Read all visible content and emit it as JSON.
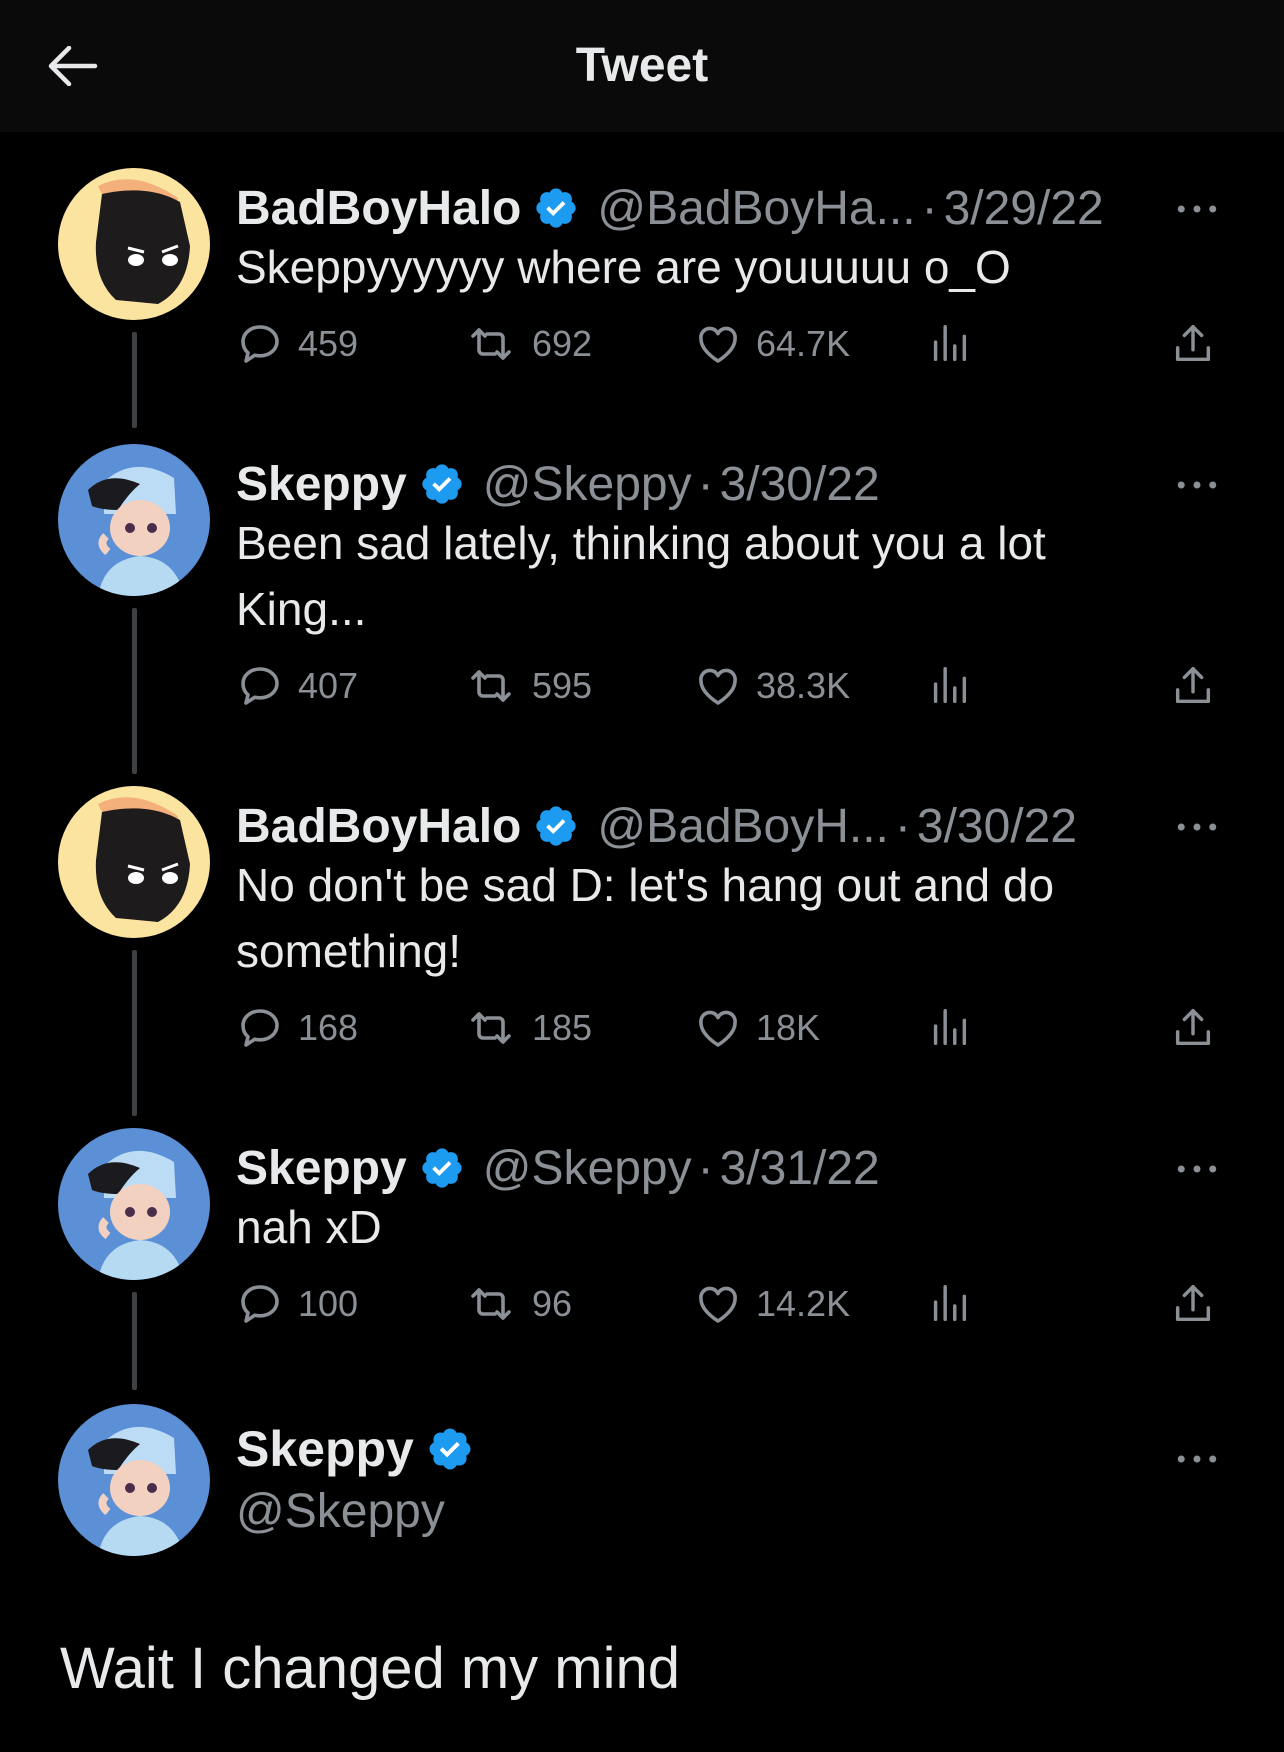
{
  "header": {
    "title": "Tweet"
  },
  "tweets": [
    {
      "name": "BadBoyHalo",
      "handle": "@BadBoyHa...",
      "date": "3/29/22",
      "text": "Skeppyyyyyy where are youuuuu o_O",
      "replies": "459",
      "retweets": "692",
      "likes": "64.7K"
    },
    {
      "name": "Skeppy",
      "handle": "@Skeppy",
      "date": "3/30/22",
      "text": "Been sad lately, thinking about you a lot King...",
      "replies": "407",
      "retweets": "595",
      "likes": "38.3K"
    },
    {
      "name": "BadBoyHalo",
      "handle": "@BadBoyH...",
      "date": "3/30/22",
      "text": "No don't be sad D: let's hang out and do something!",
      "replies": "168",
      "retweets": "185",
      "likes": "18K"
    },
    {
      "name": "Skeppy",
      "handle": "@Skeppy",
      "date": "3/31/22",
      "text": "nah xD",
      "replies": "100",
      "retweets": "96",
      "likes": "14.2K"
    }
  ],
  "main_tweet": {
    "name": "Skeppy",
    "handle": "@Skeppy",
    "text": "Wait I changed my mind"
  },
  "colors": {
    "background": "#000000",
    "text": "#e7e9ea",
    "muted": "#8b9096",
    "verified": "#1d9bf0"
  },
  "icons": [
    "back-arrow-icon",
    "verified-icon",
    "more-icon",
    "reply-icon",
    "retweet-icon",
    "like-icon",
    "views-icon",
    "share-icon"
  ]
}
